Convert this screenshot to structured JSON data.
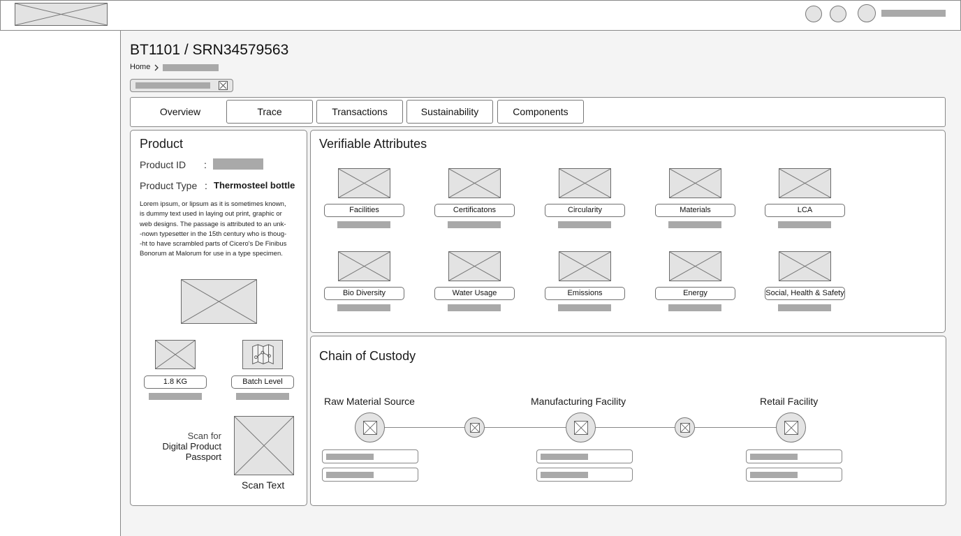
{
  "page": {
    "title": "BT1101 / SRN34579563",
    "breadcrumb_home": "Home"
  },
  "tabs": [
    "Overview",
    "Trace",
    "Transactions",
    "Sustainability",
    "Components"
  ],
  "product": {
    "heading": "Product",
    "id_label": "Product ID",
    "separator": ":",
    "type_label": "Product Type",
    "type_value": "Thermosteel bottle",
    "description_lines": [
      "Lorem ipsum, or lipsum as it is sometimes known,",
      "is dummy text used in laying out print, graphic or",
      "web designs. The passage is attributed to an unk-",
      "-nown typesetter in the 15th century who is thoug-",
      "-ht to have scrambled parts of Cicero's De Finibus",
      "Bonorum at Malorum for use in a type specimen."
    ],
    "weight_label": "1.8 KG",
    "batch_label": "Batch Level",
    "scan_line1": "Scan for",
    "scan_line2": "Digital Product",
    "scan_line3": "Passport",
    "scan_text": "Scan Text"
  },
  "attributes": {
    "heading": "Verifiable Attributes",
    "items": [
      "Facilities",
      "Certificatons",
      "Circularity",
      "Materials",
      "LCA",
      "Bio Diversity",
      "Water Usage",
      "Emissions",
      "Energy",
      "Social, Health & Safety"
    ]
  },
  "custody": {
    "heading": "Chain of Custody",
    "stages": [
      "Raw Material Source",
      "Manufacturing Facility",
      "Retail Facility"
    ]
  },
  "icons": {
    "user_avatar": "user-avatar-icon",
    "breadcrumb_separator": "chevron-right-icon",
    "close": "close-icon",
    "map": "map-icon"
  }
}
